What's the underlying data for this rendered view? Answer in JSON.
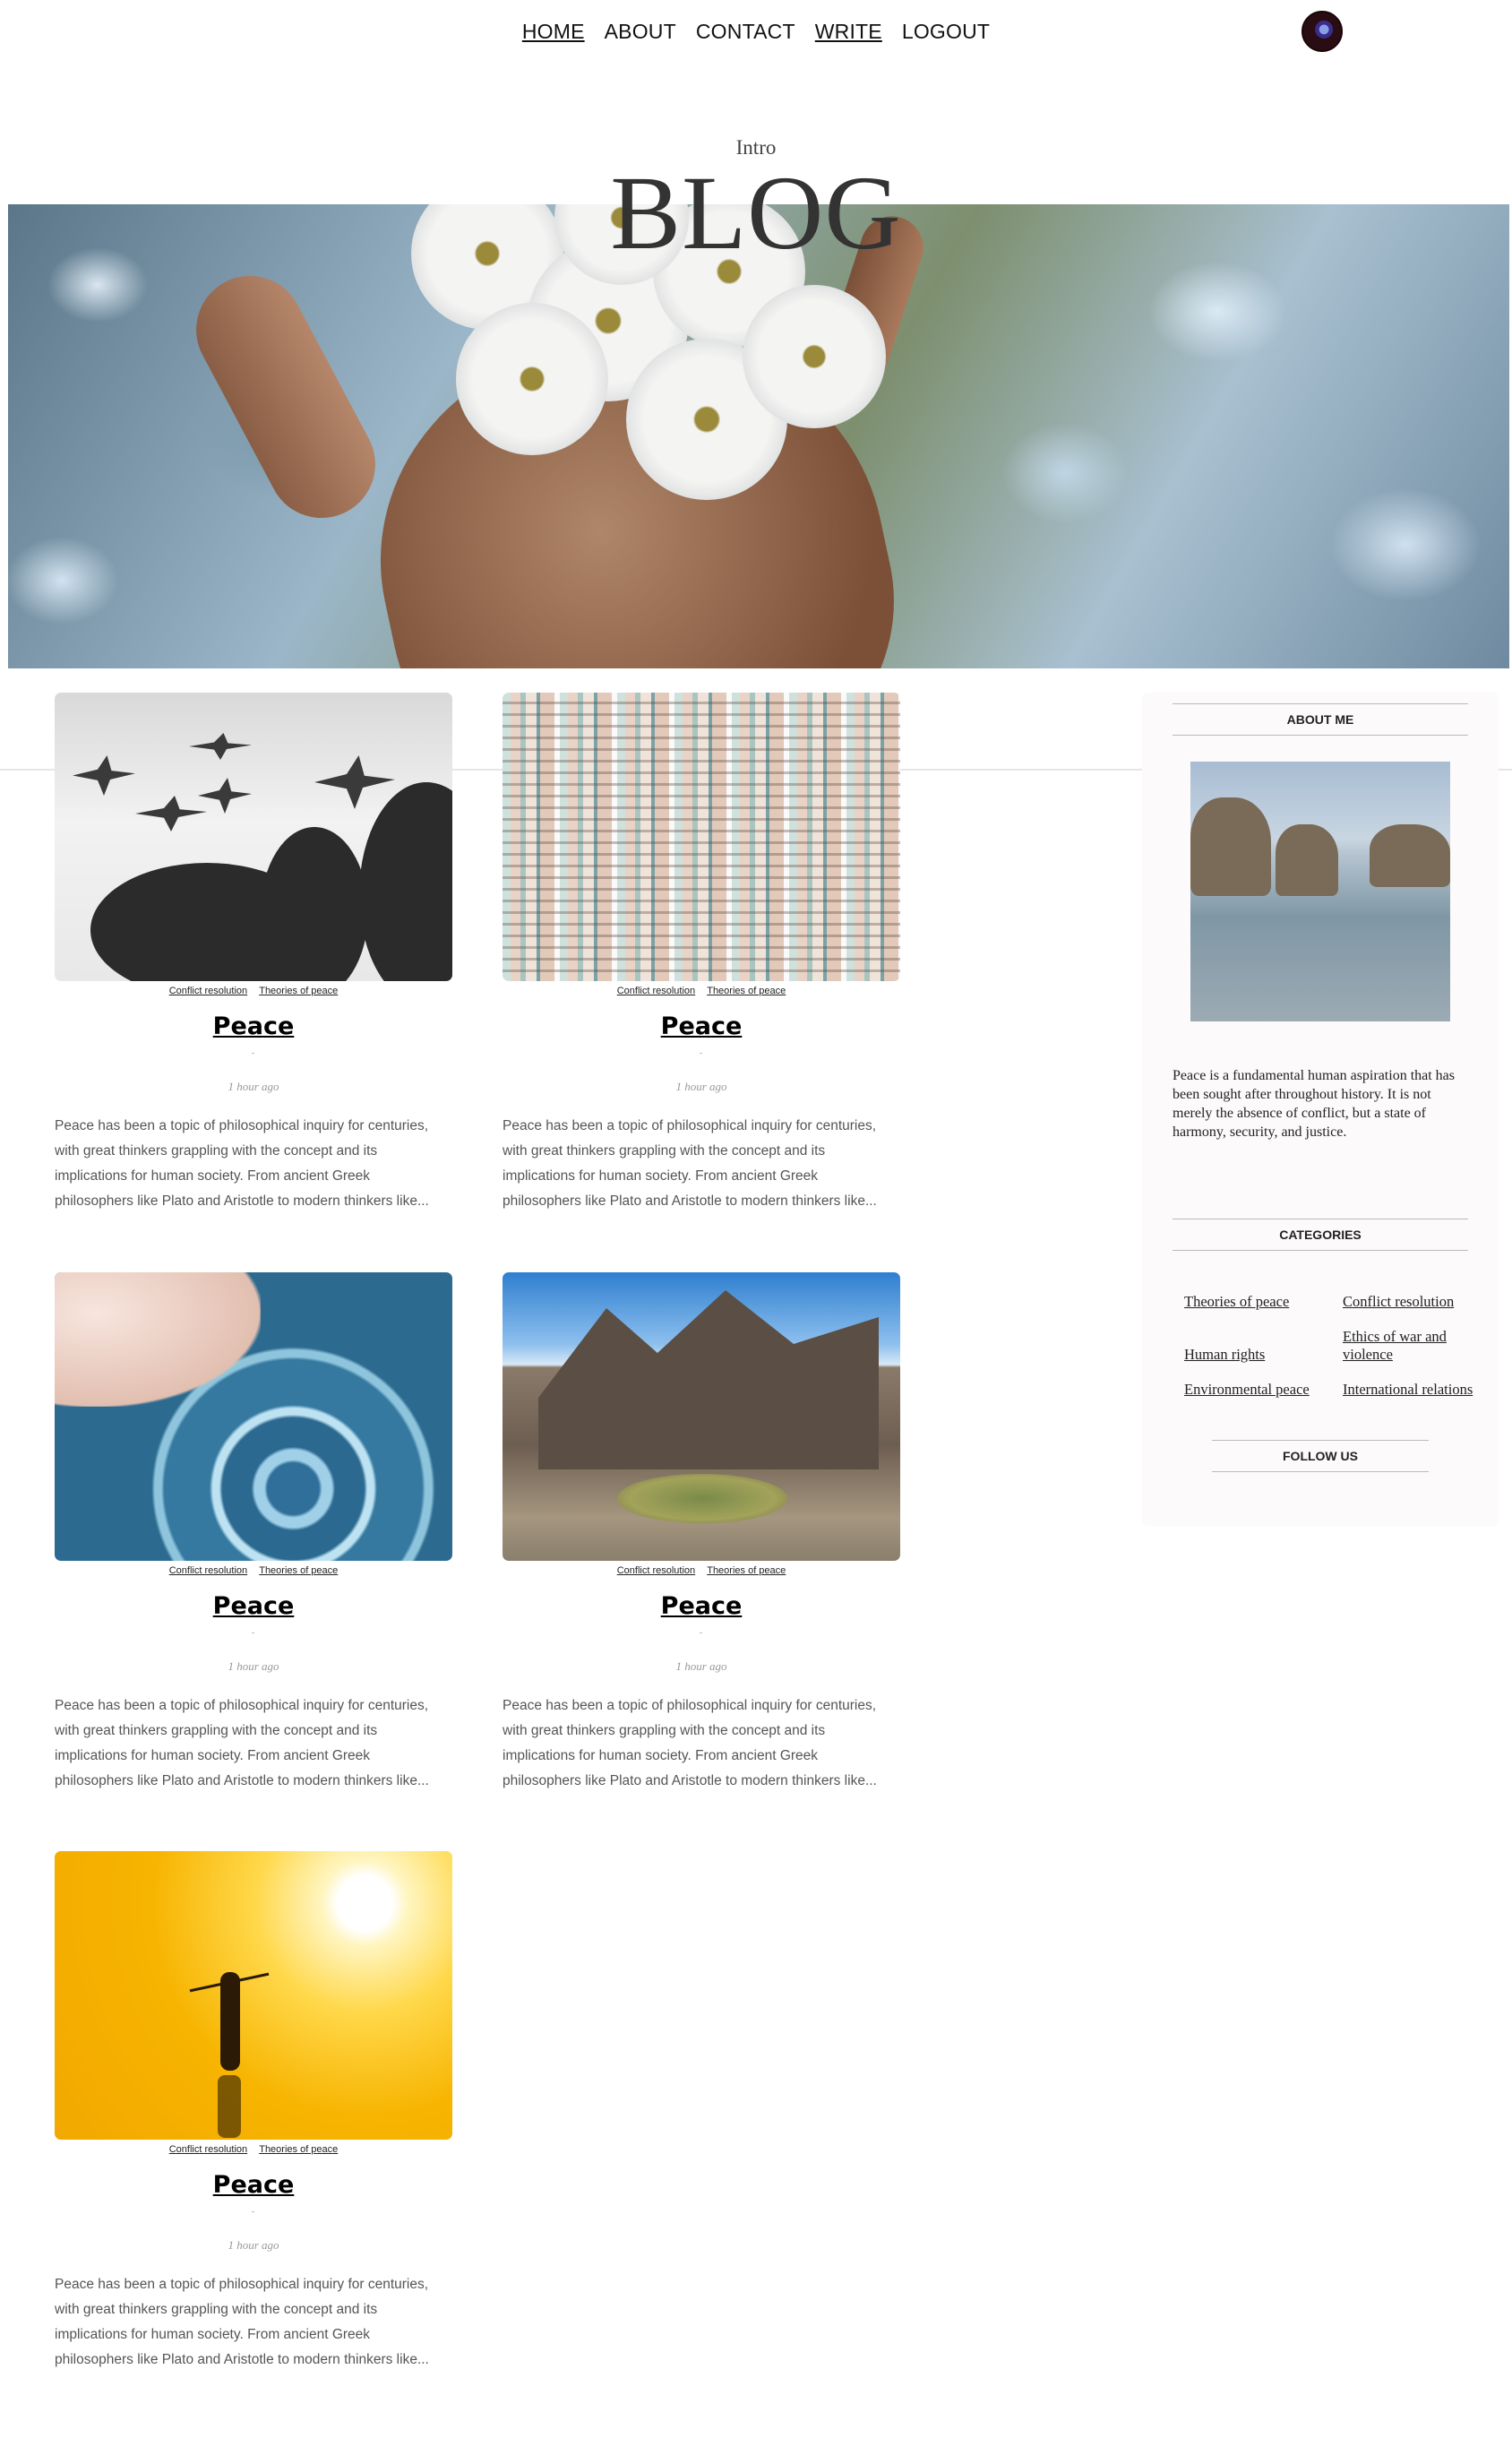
{
  "nav": {
    "links": [
      "HOME",
      "ABOUT",
      "CONTACT",
      "WRITE",
      "LOGOUT"
    ]
  },
  "header": {
    "intro": "Intro",
    "title": "BLOG"
  },
  "posts": [
    {
      "categories": [
        "Conflict resolution",
        "Theories of peace"
      ],
      "title": "Peace",
      "time": "1 hour ago",
      "description": "Peace has been a topic of philosophical inquiry for centuries, with great thinkers grappling with the concept and its implications for human society. From ancient Greek philosophers like Plato and Aristotle to modern thinkers like..."
    },
    {
      "categories": [
        "Conflict resolution",
        "Theories of peace"
      ],
      "title": "Peace",
      "time": "1 hour ago",
      "description": "Peace has been a topic of philosophical inquiry for centuries, with great thinkers grappling with the concept and its implications for human society. From ancient Greek philosophers like Plato and Aristotle to modern thinkers like..."
    },
    {
      "categories": [
        "Conflict resolution",
        "Theories of peace"
      ],
      "title": "Peace",
      "time": "1 hour ago",
      "description": "Peace has been a topic of philosophical inquiry for centuries, with great thinkers grappling with the concept and its implications for human society. From ancient Greek philosophers like Plato and Aristotle to modern thinkers like..."
    },
    {
      "categories": [
        "Conflict resolution",
        "Theories of peace"
      ],
      "title": "Peace",
      "time": "1 hour ago",
      "description": "Peace has been a topic of philosophical inquiry for centuries, with great thinkers grappling with the concept and its implications for human society. From ancient Greek philosophers like Plato and Aristotle to modern thinkers like..."
    },
    {
      "categories": [
        "Conflict resolution",
        "Theories of peace"
      ],
      "title": "Peace",
      "time": "1 hour ago",
      "description": "Peace has been a topic of philosophical inquiry for centuries, with great thinkers grappling with the concept and its implications for human society. From ancient Greek philosophers like Plato and Aristotle to modern thinkers like..."
    }
  ],
  "sidebar": {
    "about_title": "ABOUT ME",
    "about_text": "Peace is a fundamental human aspiration that has been sought after throughout history. It is not merely the absence of conflict, but a state of harmony, security, and justice.",
    "categories_title": "CATEGORIES",
    "categories": [
      "Theories of peace",
      "Conflict resolution",
      "Human rights",
      "Ethics of war and violence",
      "Environmental peace",
      "International relations"
    ],
    "follow_title": "FOLLOW US"
  }
}
